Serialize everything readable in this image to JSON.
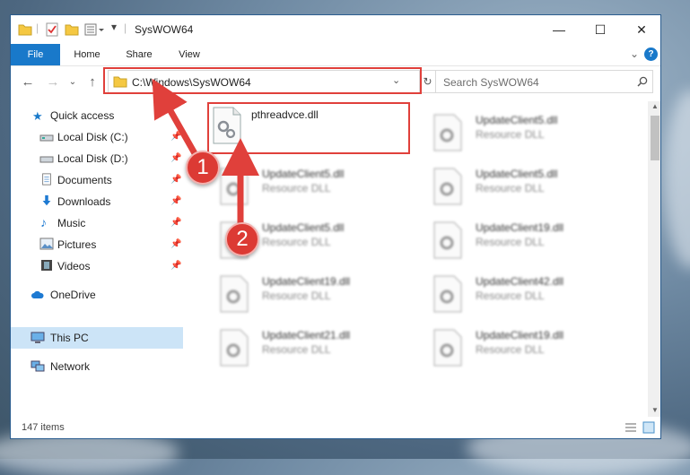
{
  "window": {
    "title": "SysWOW64",
    "controls": {
      "minimize": "—",
      "maximize": "☐",
      "close": "✕"
    },
    "help": "?"
  },
  "ribbon": {
    "tabs": [
      "File",
      "Home",
      "Share",
      "View"
    ]
  },
  "address": {
    "path": "C:\\Windows\\SysWOW64",
    "search_placeholder": "Search SysWOW64"
  },
  "nav": {
    "quick_access": "Quick access",
    "items": [
      "Local Disk (C:)",
      "Local Disk (D:)",
      "Documents",
      "Downloads",
      "Music",
      "Pictures",
      "Videos"
    ],
    "onedrive": "OneDrive",
    "this_pc": "This PC",
    "network": "Network"
  },
  "files": [
    {
      "name": "pthreadvce.dll",
      "type": ""
    },
    {
      "name": "UpdateClient5.dll",
      "type": "Resource DLL"
    },
    {
      "name": "UpdateClient5.dll",
      "type": "Resource DLL"
    },
    {
      "name": "UpdateClient5.dll",
      "type": "Resource DLL"
    },
    {
      "name": "UpdateClient5.dll",
      "type": "Resource DLL"
    },
    {
      "name": "UpdateClient19.dll",
      "type": "Resource DLL"
    },
    {
      "name": "UpdateClient19.dll",
      "type": "Resource DLL"
    },
    {
      "name": "UpdateClient42.dll",
      "type": "Resource DLL"
    },
    {
      "name": "UpdateClient21.dll",
      "type": "Resource DLL"
    },
    {
      "name": "UpdateClient19.dll",
      "type": "Resource DLL"
    }
  ],
  "status": {
    "count": "147 items"
  },
  "annotations": {
    "step1": "1",
    "step2": "2"
  },
  "colors": {
    "accent": "#1979ca",
    "annotation": "#e0403b",
    "selection": "#cce4f7"
  }
}
